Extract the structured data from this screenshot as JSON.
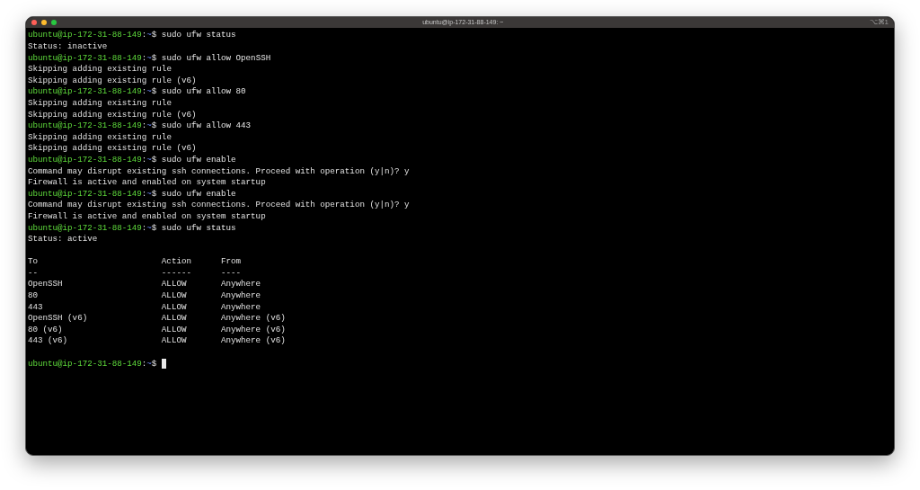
{
  "window": {
    "title": "ubuntu@ip-172-31-88-149: ~",
    "shortcut": "⌥⌘1"
  },
  "lines": [
    {
      "kind": "prompt",
      "host": "ubuntu@ip-172-31-88-149",
      "sep": ":",
      "path": "~",
      "command": "$ sudo ufw status"
    },
    {
      "kind": "output",
      "text": "Status: inactive"
    },
    {
      "kind": "prompt",
      "host": "ubuntu@ip-172-31-88-149",
      "sep": ":",
      "path": "~",
      "command": "$ sudo ufw allow OpenSSH"
    },
    {
      "kind": "output",
      "text": "Skipping adding existing rule"
    },
    {
      "kind": "output",
      "text": "Skipping adding existing rule (v6)"
    },
    {
      "kind": "prompt",
      "host": "ubuntu@ip-172-31-88-149",
      "sep": ":",
      "path": "~",
      "command": "$ sudo ufw allow 80"
    },
    {
      "kind": "output",
      "text": "Skipping adding existing rule"
    },
    {
      "kind": "output",
      "text": "Skipping adding existing rule (v6)"
    },
    {
      "kind": "prompt",
      "host": "ubuntu@ip-172-31-88-149",
      "sep": ":",
      "path": "~",
      "command": "$ sudo ufw allow 443"
    },
    {
      "kind": "output",
      "text": "Skipping adding existing rule"
    },
    {
      "kind": "output",
      "text": "Skipping adding existing rule (v6)"
    },
    {
      "kind": "prompt",
      "host": "ubuntu@ip-172-31-88-149",
      "sep": ":",
      "path": "~",
      "command": "$ sudo ufw enable"
    },
    {
      "kind": "output",
      "text": "Command may disrupt existing ssh connections. Proceed with operation (y|n)? y"
    },
    {
      "kind": "output",
      "text": "Firewall is active and enabled on system startup"
    },
    {
      "kind": "prompt",
      "host": "ubuntu@ip-172-31-88-149",
      "sep": ":",
      "path": "~",
      "command": "$ sudo ufw enable"
    },
    {
      "kind": "output",
      "text": "Command may disrupt existing ssh connections. Proceed with operation (y|n)? y"
    },
    {
      "kind": "output",
      "text": "Firewall is active and enabled on system startup"
    },
    {
      "kind": "prompt",
      "host": "ubuntu@ip-172-31-88-149",
      "sep": ":",
      "path": "~",
      "command": "$ sudo ufw status"
    },
    {
      "kind": "output",
      "text": "Status: active"
    },
    {
      "kind": "blank"
    },
    {
      "kind": "row",
      "cells": [
        "To",
        "Action",
        "From"
      ]
    },
    {
      "kind": "row",
      "cells": [
        "--",
        "------",
        "----"
      ]
    },
    {
      "kind": "row",
      "cells": [
        "OpenSSH",
        "ALLOW",
        "Anywhere"
      ]
    },
    {
      "kind": "row",
      "cells": [
        "80",
        "ALLOW",
        "Anywhere"
      ]
    },
    {
      "kind": "row",
      "cells": [
        "443",
        "ALLOW",
        "Anywhere"
      ]
    },
    {
      "kind": "row",
      "cells": [
        "OpenSSH (v6)",
        "ALLOW",
        "Anywhere (v6)"
      ]
    },
    {
      "kind": "row",
      "cells": [
        "80 (v6)",
        "ALLOW",
        "Anywhere (v6)"
      ]
    },
    {
      "kind": "row",
      "cells": [
        "443 (v6)",
        "ALLOW",
        "Anywhere (v6)"
      ]
    },
    {
      "kind": "blank"
    },
    {
      "kind": "prompt",
      "host": "ubuntu@ip-172-31-88-149",
      "sep": ":",
      "path": "~",
      "command": "$",
      "cursor": true
    }
  ]
}
